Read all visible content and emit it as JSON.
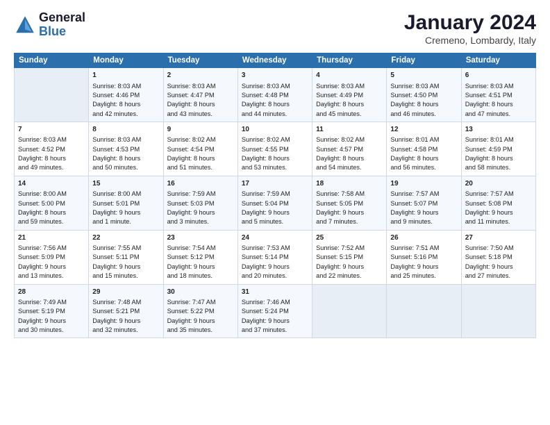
{
  "header": {
    "logo_general": "General",
    "logo_blue": "Blue",
    "month": "January 2024",
    "location": "Cremeno, Lombardy, Italy"
  },
  "days_of_week": [
    "Sunday",
    "Monday",
    "Tuesday",
    "Wednesday",
    "Thursday",
    "Friday",
    "Saturday"
  ],
  "weeks": [
    [
      {
        "day": "",
        "info": ""
      },
      {
        "day": "1",
        "info": "Sunrise: 8:03 AM\nSunset: 4:46 PM\nDaylight: 8 hours\nand 42 minutes."
      },
      {
        "day": "2",
        "info": "Sunrise: 8:03 AM\nSunset: 4:47 PM\nDaylight: 8 hours\nand 43 minutes."
      },
      {
        "day": "3",
        "info": "Sunrise: 8:03 AM\nSunset: 4:48 PM\nDaylight: 8 hours\nand 44 minutes."
      },
      {
        "day": "4",
        "info": "Sunrise: 8:03 AM\nSunset: 4:49 PM\nDaylight: 8 hours\nand 45 minutes."
      },
      {
        "day": "5",
        "info": "Sunrise: 8:03 AM\nSunset: 4:50 PM\nDaylight: 8 hours\nand 46 minutes."
      },
      {
        "day": "6",
        "info": "Sunrise: 8:03 AM\nSunset: 4:51 PM\nDaylight: 8 hours\nand 47 minutes."
      }
    ],
    [
      {
        "day": "7",
        "info": "Sunrise: 8:03 AM\nSunset: 4:52 PM\nDaylight: 8 hours\nand 49 minutes."
      },
      {
        "day": "8",
        "info": "Sunrise: 8:03 AM\nSunset: 4:53 PM\nDaylight: 8 hours\nand 50 minutes."
      },
      {
        "day": "9",
        "info": "Sunrise: 8:02 AM\nSunset: 4:54 PM\nDaylight: 8 hours\nand 51 minutes."
      },
      {
        "day": "10",
        "info": "Sunrise: 8:02 AM\nSunset: 4:55 PM\nDaylight: 8 hours\nand 53 minutes."
      },
      {
        "day": "11",
        "info": "Sunrise: 8:02 AM\nSunset: 4:57 PM\nDaylight: 8 hours\nand 54 minutes."
      },
      {
        "day": "12",
        "info": "Sunrise: 8:01 AM\nSunset: 4:58 PM\nDaylight: 8 hours\nand 56 minutes."
      },
      {
        "day": "13",
        "info": "Sunrise: 8:01 AM\nSunset: 4:59 PM\nDaylight: 8 hours\nand 58 minutes."
      }
    ],
    [
      {
        "day": "14",
        "info": "Sunrise: 8:00 AM\nSunset: 5:00 PM\nDaylight: 8 hours\nand 59 minutes."
      },
      {
        "day": "15",
        "info": "Sunrise: 8:00 AM\nSunset: 5:01 PM\nDaylight: 9 hours\nand 1 minute."
      },
      {
        "day": "16",
        "info": "Sunrise: 7:59 AM\nSunset: 5:03 PM\nDaylight: 9 hours\nand 3 minutes."
      },
      {
        "day": "17",
        "info": "Sunrise: 7:59 AM\nSunset: 5:04 PM\nDaylight: 9 hours\nand 5 minutes."
      },
      {
        "day": "18",
        "info": "Sunrise: 7:58 AM\nSunset: 5:05 PM\nDaylight: 9 hours\nand 7 minutes."
      },
      {
        "day": "19",
        "info": "Sunrise: 7:57 AM\nSunset: 5:07 PM\nDaylight: 9 hours\nand 9 minutes."
      },
      {
        "day": "20",
        "info": "Sunrise: 7:57 AM\nSunset: 5:08 PM\nDaylight: 9 hours\nand 11 minutes."
      }
    ],
    [
      {
        "day": "21",
        "info": "Sunrise: 7:56 AM\nSunset: 5:09 PM\nDaylight: 9 hours\nand 13 minutes."
      },
      {
        "day": "22",
        "info": "Sunrise: 7:55 AM\nSunset: 5:11 PM\nDaylight: 9 hours\nand 15 minutes."
      },
      {
        "day": "23",
        "info": "Sunrise: 7:54 AM\nSunset: 5:12 PM\nDaylight: 9 hours\nand 18 minutes."
      },
      {
        "day": "24",
        "info": "Sunrise: 7:53 AM\nSunset: 5:14 PM\nDaylight: 9 hours\nand 20 minutes."
      },
      {
        "day": "25",
        "info": "Sunrise: 7:52 AM\nSunset: 5:15 PM\nDaylight: 9 hours\nand 22 minutes."
      },
      {
        "day": "26",
        "info": "Sunrise: 7:51 AM\nSunset: 5:16 PM\nDaylight: 9 hours\nand 25 minutes."
      },
      {
        "day": "27",
        "info": "Sunrise: 7:50 AM\nSunset: 5:18 PM\nDaylight: 9 hours\nand 27 minutes."
      }
    ],
    [
      {
        "day": "28",
        "info": "Sunrise: 7:49 AM\nSunset: 5:19 PM\nDaylight: 9 hours\nand 30 minutes."
      },
      {
        "day": "29",
        "info": "Sunrise: 7:48 AM\nSunset: 5:21 PM\nDaylight: 9 hours\nand 32 minutes."
      },
      {
        "day": "30",
        "info": "Sunrise: 7:47 AM\nSunset: 5:22 PM\nDaylight: 9 hours\nand 35 minutes."
      },
      {
        "day": "31",
        "info": "Sunrise: 7:46 AM\nSunset: 5:24 PM\nDaylight: 9 hours\nand 37 minutes."
      },
      {
        "day": "",
        "info": ""
      },
      {
        "day": "",
        "info": ""
      },
      {
        "day": "",
        "info": ""
      }
    ]
  ]
}
